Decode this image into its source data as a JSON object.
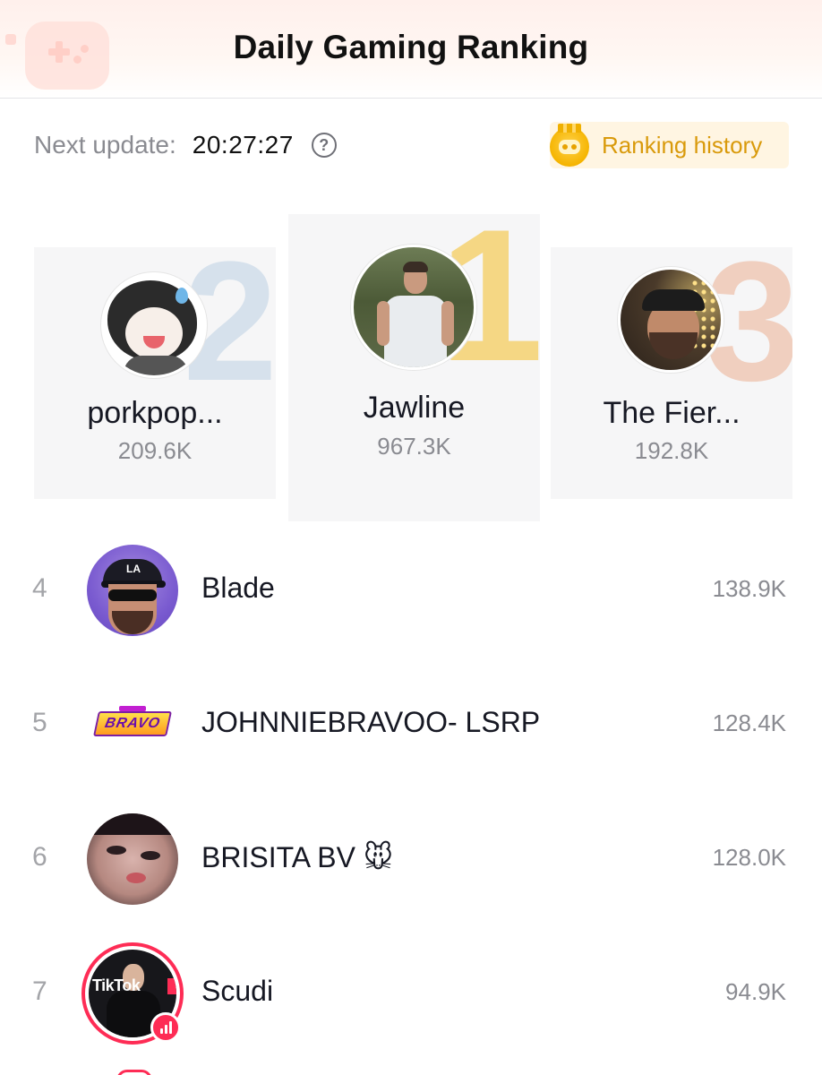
{
  "header": {
    "title": "Daily Gaming Ranking"
  },
  "update": {
    "label": "Next update:",
    "time": "20:27:27",
    "help_icon": "question-circle-icon"
  },
  "history_button": {
    "label": "Ranking history",
    "icon": "gamepad-medal-icon"
  },
  "podium": {
    "first": {
      "rank": "1",
      "name": "Jawline",
      "score": "967.3K"
    },
    "second": {
      "rank": "2",
      "name": "porkpop...",
      "score": "209.6K"
    },
    "third": {
      "rank": "3",
      "name": "The Fier...",
      "score": "192.8K"
    }
  },
  "list": [
    {
      "rank": "4",
      "name": "Blade",
      "score": "138.9K"
    },
    {
      "rank": "5",
      "name": "JOHNNIEBRAVOO- LSRP",
      "score": "128.4K",
      "logo_text": "BRAVO"
    },
    {
      "rank": "6",
      "name": "BRISITA BV 🐭",
      "score": "128.0K"
    },
    {
      "rank": "7",
      "name": "Scudi",
      "score": "94.9K",
      "live": true,
      "avatar_text": "TikTok"
    }
  ],
  "colors": {
    "accent": "#fe2c55",
    "gold": "#d99a0b",
    "history_bg": "#fff5e2",
    "muted": "#8a8b91"
  }
}
